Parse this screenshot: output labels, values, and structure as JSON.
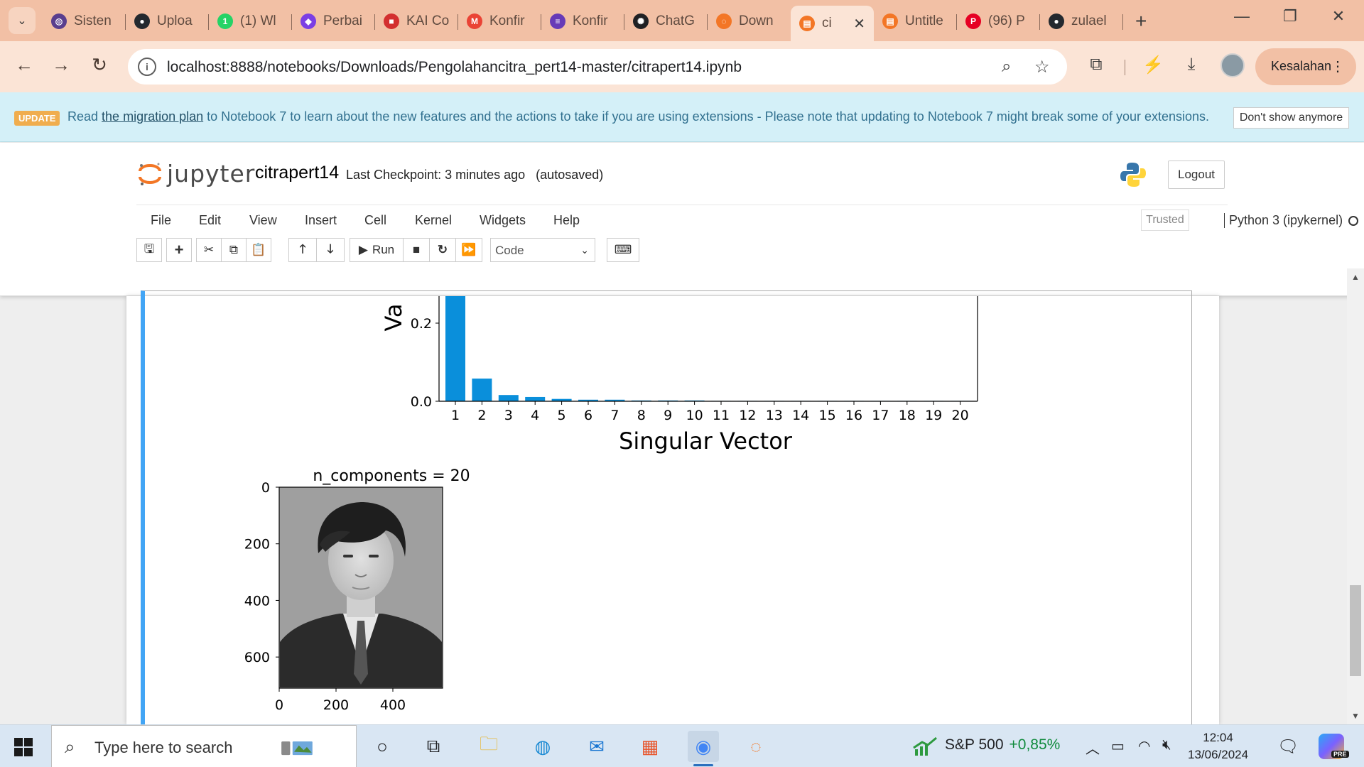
{
  "browser": {
    "tabs": [
      {
        "title": "Sisten",
        "fav_color": "#5a3e8e",
        "fav_glyph": "◎",
        "icon": "app-icon"
      },
      {
        "title": "Uploa",
        "fav_color": "#24292f",
        "fav_glyph": "●",
        "icon": "github-icon"
      },
      {
        "title": "(1) Wl",
        "fav_color": "#25d366",
        "fav_glyph": "1",
        "icon": "whatsapp-icon"
      },
      {
        "title": "Perbai",
        "fav_color": "#7b3fe4",
        "fav_glyph": "◆",
        "icon": "app-icon"
      },
      {
        "title": "KAI Co",
        "fav_color": "#d32f2f",
        "fav_glyph": "■",
        "icon": "kai-icon"
      },
      {
        "title": "Konfir",
        "fav_color": "#ea4335",
        "fav_glyph": "M",
        "icon": "gmail-icon"
      },
      {
        "title": "Konfir",
        "fav_color": "#673ab7",
        "fav_glyph": "≡",
        "icon": "forms-icon"
      },
      {
        "title": "ChatG",
        "fav_color": "#202124",
        "fav_glyph": "✺",
        "icon": "chatgpt-icon"
      },
      {
        "title": "Down",
        "fav_color": "#f37626",
        "fav_glyph": "◌",
        "icon": "jupyter-icon"
      },
      {
        "title": "ci",
        "fav_color": "#f37626",
        "fav_glyph": "▤",
        "icon": "notebook-icon",
        "active": true
      },
      {
        "title": "Untitle",
        "fav_color": "#f37626",
        "fav_glyph": "▤",
        "icon": "notebook-icon"
      },
      {
        "title": "(96) P",
        "fav_color": "#e60023",
        "fav_glyph": "P",
        "icon": "pinterest-icon"
      },
      {
        "title": "zulael",
        "fav_color": "#24292f",
        "fav_glyph": "●",
        "icon": "github-icon"
      }
    ],
    "url": "localhost:8888/notebooks/Downloads/Pengolahancitra_pert14-master/citrapert14.ipynb",
    "profile_label": "Kesalahan"
  },
  "banner": {
    "badge": "UPDATE",
    "text_before": "Read ",
    "link": "the migration plan",
    "text_after": " to Notebook 7 to learn about the new features and the actions to take if you are using extensions - Please note that updating to Notebook 7 might break some of your extensions.",
    "dismiss": "Don't show anymore"
  },
  "jupyter": {
    "logo_text": "jupyter",
    "notebook_name": "citrapert14",
    "checkpoint": "Last Checkpoint: 3 minutes ago",
    "autosave": "(autosaved)",
    "logout": "Logout",
    "menus": [
      "File",
      "Edit",
      "View",
      "Insert",
      "Cell",
      "Kernel",
      "Widgets",
      "Help"
    ],
    "trusted": "Trusted",
    "kernel": "Python 3 (ipykernel)",
    "run_label": "Run",
    "cell_type": "Code"
  },
  "chart_data": [
    {
      "type": "bar",
      "categories": [
        "1",
        "2",
        "3",
        "4",
        "5",
        "6",
        "7",
        "8",
        "9",
        "10",
        "11",
        "12",
        "13",
        "14",
        "15",
        "16",
        "17",
        "18",
        "19",
        "20"
      ],
      "values": [
        0.62,
        0.058,
        0.016,
        0.011,
        0.006,
        0.004,
        0.004,
        0.002,
        0.002,
        0.002,
        0.001,
        0.001,
        0.001,
        0.001,
        0.001,
        0.001,
        0.001,
        0.001,
        0.001,
        0.001
      ],
      "xlabel": "Singular Vector",
      "ylabel_visible": "Va",
      "yticks": [
        "0.0",
        "0.2"
      ],
      "color": "#0a8fdb"
    },
    {
      "type": "image",
      "title": "n_components = 20",
      "xticks": [
        "0",
        "200",
        "400"
      ],
      "yticks": [
        "0",
        "200",
        "400",
        "600"
      ]
    }
  ],
  "taskbar": {
    "search_placeholder": "Type here to search",
    "stock_name": "S&P 500",
    "stock_change": "+0,85%",
    "time": "12:04",
    "date": "13/06/2024"
  }
}
